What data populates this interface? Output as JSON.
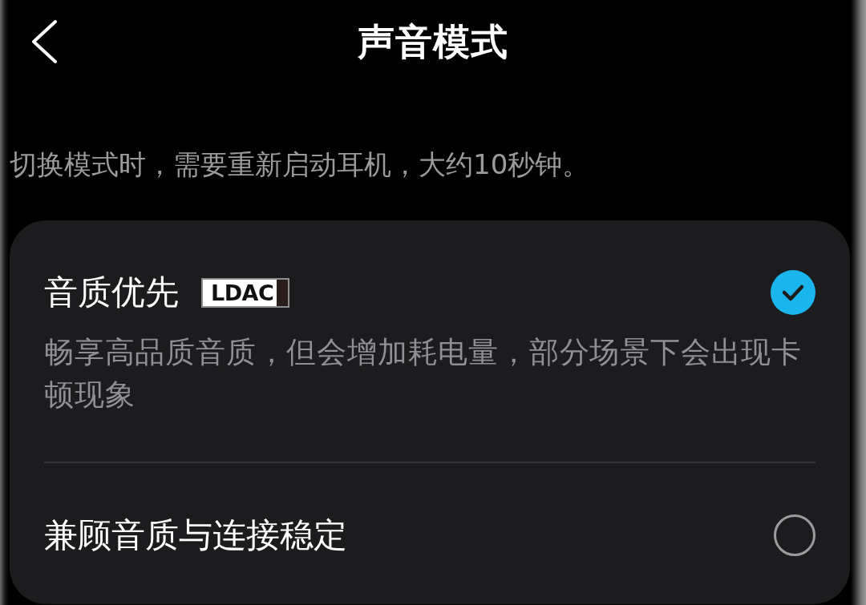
{
  "header": {
    "title": "声音模式"
  },
  "note": "切换模式时，需要重新启动耳机，大约10秒钟。",
  "modes": [
    {
      "title": "音质优先",
      "badge": "LDAC",
      "description": "畅享高品质音质，但会增加耗电量，部分场景下会出现卡顿现象",
      "selected": true
    },
    {
      "title": "兼顾音质与连接稳定",
      "selected": false
    }
  ]
}
